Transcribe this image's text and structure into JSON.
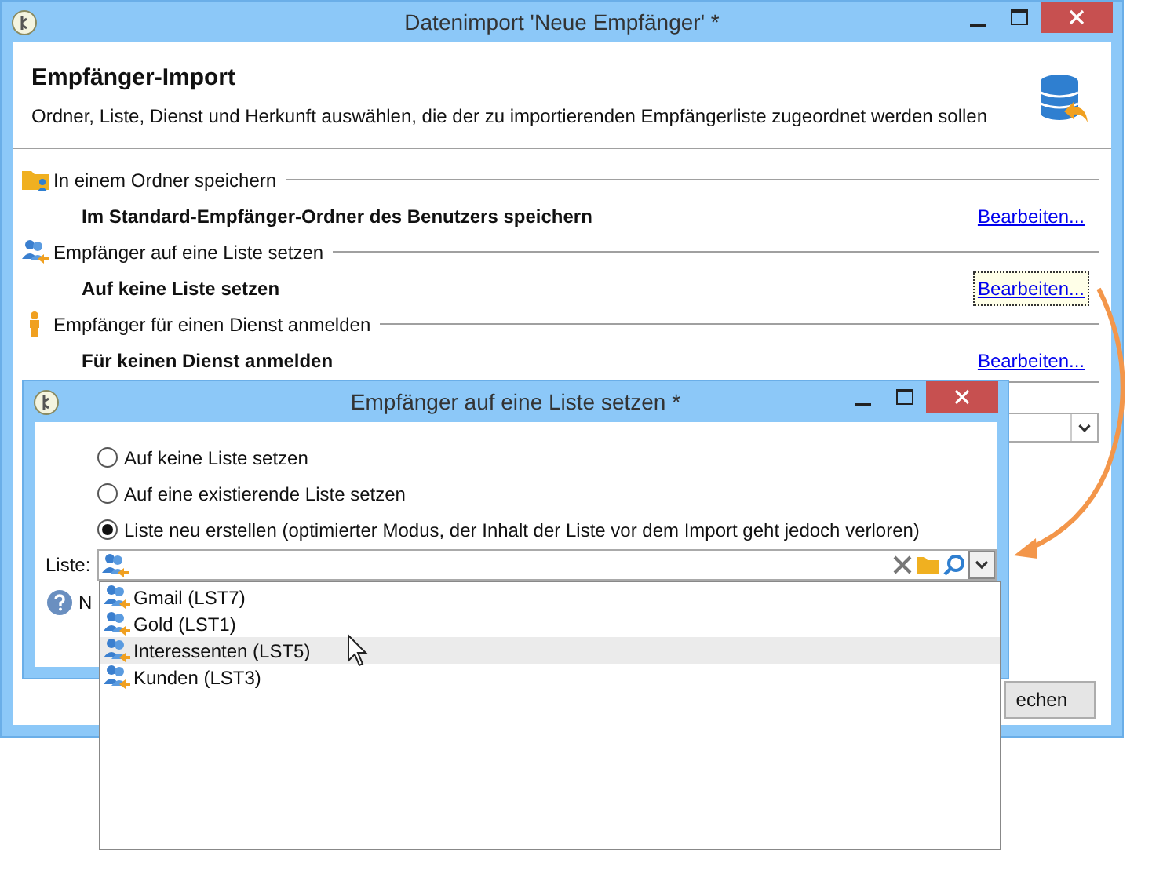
{
  "window": {
    "title": "Datenimport 'Neue Empfänger' *"
  },
  "header": {
    "title": "Empfänger-Import",
    "description": "Ordner, Liste, Dienst und Herkunft auswählen, die der zu importierenden Empfängerliste zugeordnet werden sollen"
  },
  "sections": [
    {
      "kind": "folder",
      "label": "In einem Ordner speichern",
      "value": "Im Standard-Empfänger-Ordner des Benutzers speichern",
      "link": "Bearbeiten...",
      "focused": false
    },
    {
      "kind": "list",
      "label": "Empfänger auf eine Liste setzen",
      "value": "Auf keine Liste setzen",
      "link": "Bearbeiten...",
      "focused": true
    },
    {
      "kind": "service",
      "label": "Empfänger für einen Dienst anmelden",
      "value": "Für keinen Dienst anmelden",
      "link": "Bearbeiten...",
      "focused": false
    }
  ],
  "footer_button": "echen",
  "dialog": {
    "title": "Empfänger auf eine Liste setzen *",
    "options": [
      {
        "label": "Auf keine Liste setzen",
        "selected": false
      },
      {
        "label": "Auf eine existierende Liste setzen",
        "selected": false
      },
      {
        "label": "Liste neu erstellen (optimierter Modus, der Inhalt der Liste vor dem Import geht jedoch verloren)",
        "selected": true
      }
    ],
    "field_label": "Liste:",
    "help_text": "N",
    "dropdown": [
      {
        "label": "Gmail (LST7)",
        "highlighted": false
      },
      {
        "label": "Gold (LST1)",
        "highlighted": false
      },
      {
        "label": "Interessenten (LST5)",
        "highlighted": true
      },
      {
        "label": "Kunden (LST3)",
        "highlighted": false
      }
    ]
  }
}
